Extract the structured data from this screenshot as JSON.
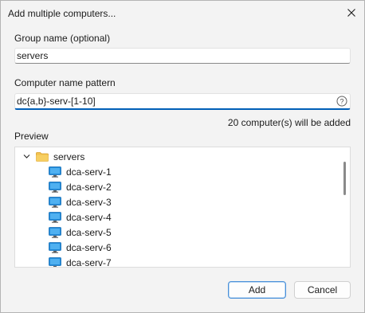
{
  "dialog": {
    "title": "Add multiple computers..."
  },
  "group_name": {
    "label": "Group name (optional)",
    "value": "servers"
  },
  "name_pattern": {
    "label": "Computer name pattern",
    "value": "dc{a,b}-serv-[1-10]"
  },
  "status_text": "20 computer(s) will be added",
  "preview": {
    "label": "Preview",
    "group": {
      "name": "servers",
      "expanded": true
    },
    "computers": [
      "dca-serv-1",
      "dca-serv-2",
      "dca-serv-3",
      "dca-serv-4",
      "dca-serv-5",
      "dca-serv-6",
      "dca-serv-7"
    ]
  },
  "buttons": {
    "add": "Add",
    "cancel": "Cancel"
  },
  "colors": {
    "accent": "#005fb8",
    "folder": "#f2c14e",
    "monitor": "#1e88d8"
  }
}
